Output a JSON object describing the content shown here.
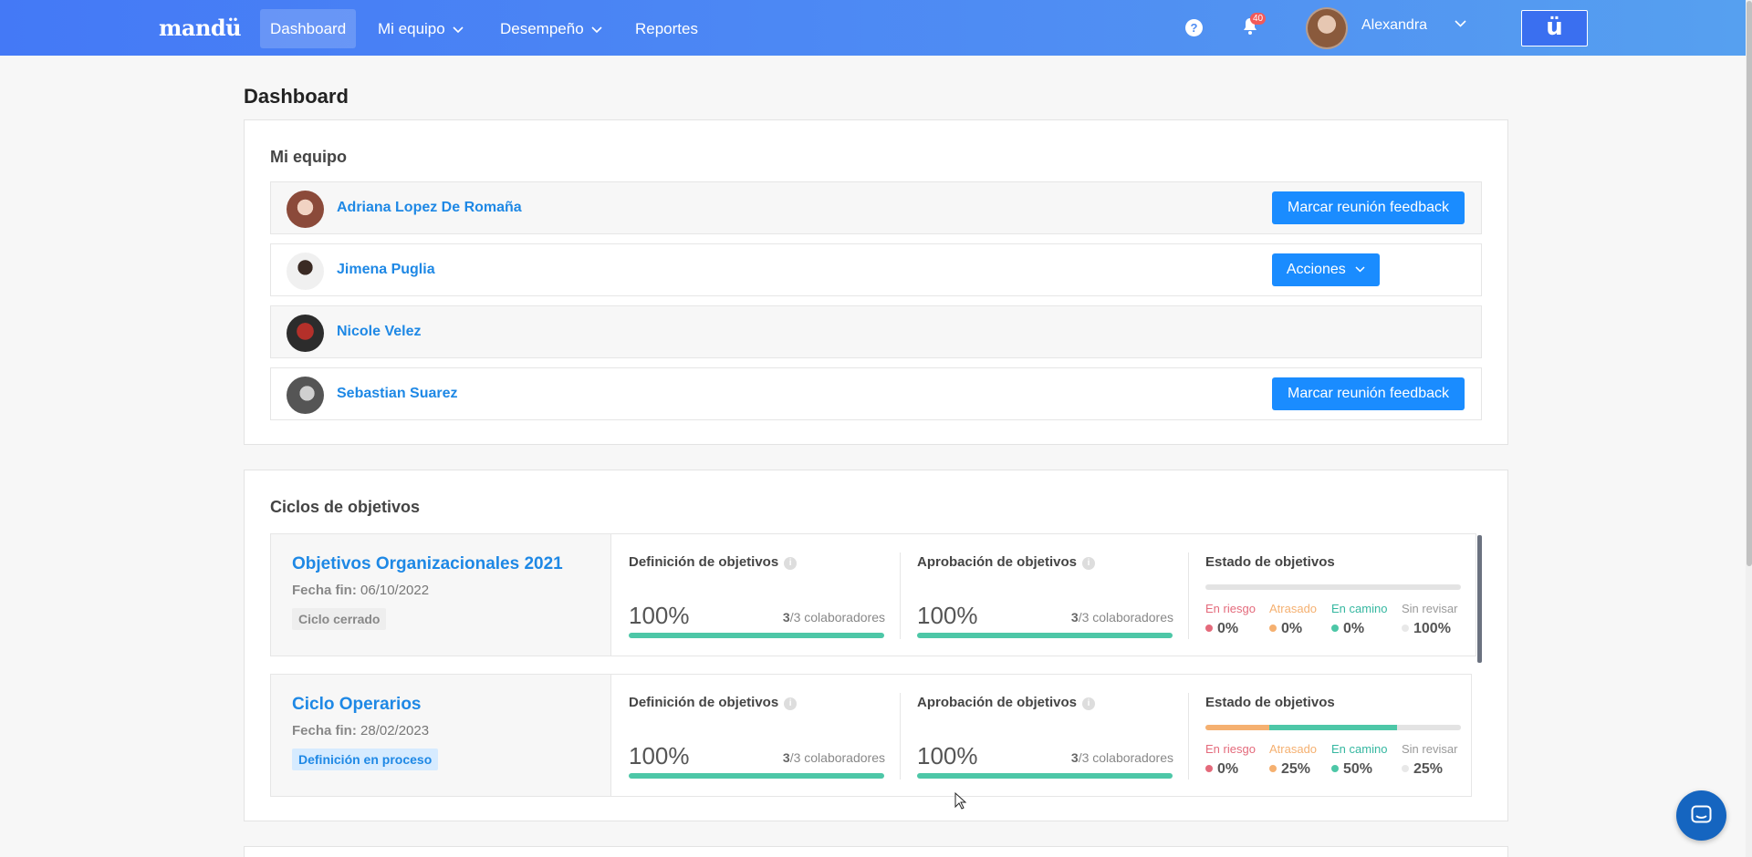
{
  "navbar": {
    "logo": "mandü",
    "items": [
      {
        "label": "Dashboard",
        "active": true
      },
      {
        "label": "Mi equipo",
        "dropdown": true
      },
      {
        "label": "Desempeño",
        "dropdown": true
      },
      {
        "label": "Reportes"
      }
    ],
    "help_icon": "question-circle-icon",
    "notifications_count": "40",
    "user_name": "Alexandra",
    "brand_button": "ü"
  },
  "page": {
    "title": "Dashboard"
  },
  "team": {
    "title": "Mi equipo",
    "members": [
      {
        "name": "Adriana Lopez De Romaña",
        "action": "Marcar reunión feedback"
      },
      {
        "name": "Jimena Puglia",
        "action": "Acciones"
      },
      {
        "name": "Nicole Velez",
        "action": ""
      },
      {
        "name": "Sebastian Suarez",
        "action": "Marcar reunión feedback"
      }
    ]
  },
  "cycles": {
    "title": "Ciclos de objetivos",
    "date_label": "Fecha fin:",
    "status_title": "Estado de objetivos",
    "status_labels": [
      "En riesgo",
      "Atrasado",
      "En camino",
      "Sin revisar"
    ],
    "status_colors": [
      "#e46a7b",
      "#f5b070",
      "#4dc7a7",
      "#e3e3e3"
    ],
    "items": [
      {
        "name": "Objetivos Organizacionales 2021",
        "end_date": "06/10/2022",
        "tag": "Ciclo cerrado",
        "phases": [
          {
            "title": "Definición de objetivos",
            "pct": "100%",
            "count": "3",
            "total": "/3 colaboradores",
            "progress": 1.0
          },
          {
            "title": "Aprobación de objetivos",
            "pct": "100%",
            "count": "3",
            "total": "/3 colaboradores",
            "progress": 1.0
          }
        ],
        "status_values": [
          "0%",
          "0%",
          "0%",
          "100%"
        ],
        "status_fractions": [
          0,
          0,
          0,
          1.0
        ]
      },
      {
        "name": "Ciclo Operarios",
        "end_date": "28/02/2023",
        "tag": "Definición en proceso",
        "phases": [
          {
            "title": "Definición de objetivos",
            "pct": "100%",
            "count": "3",
            "total": "/3 colaboradores",
            "progress": 1.0
          },
          {
            "title": "Aprobación de objetivos",
            "pct": "100%",
            "count": "3",
            "total": "/3 colaboradores",
            "progress": 1.0
          }
        ],
        "status_values": [
          "0%",
          "25%",
          "50%",
          "25%"
        ],
        "status_fractions": [
          0,
          0.25,
          0.5,
          0.25
        ]
      }
    ]
  }
}
